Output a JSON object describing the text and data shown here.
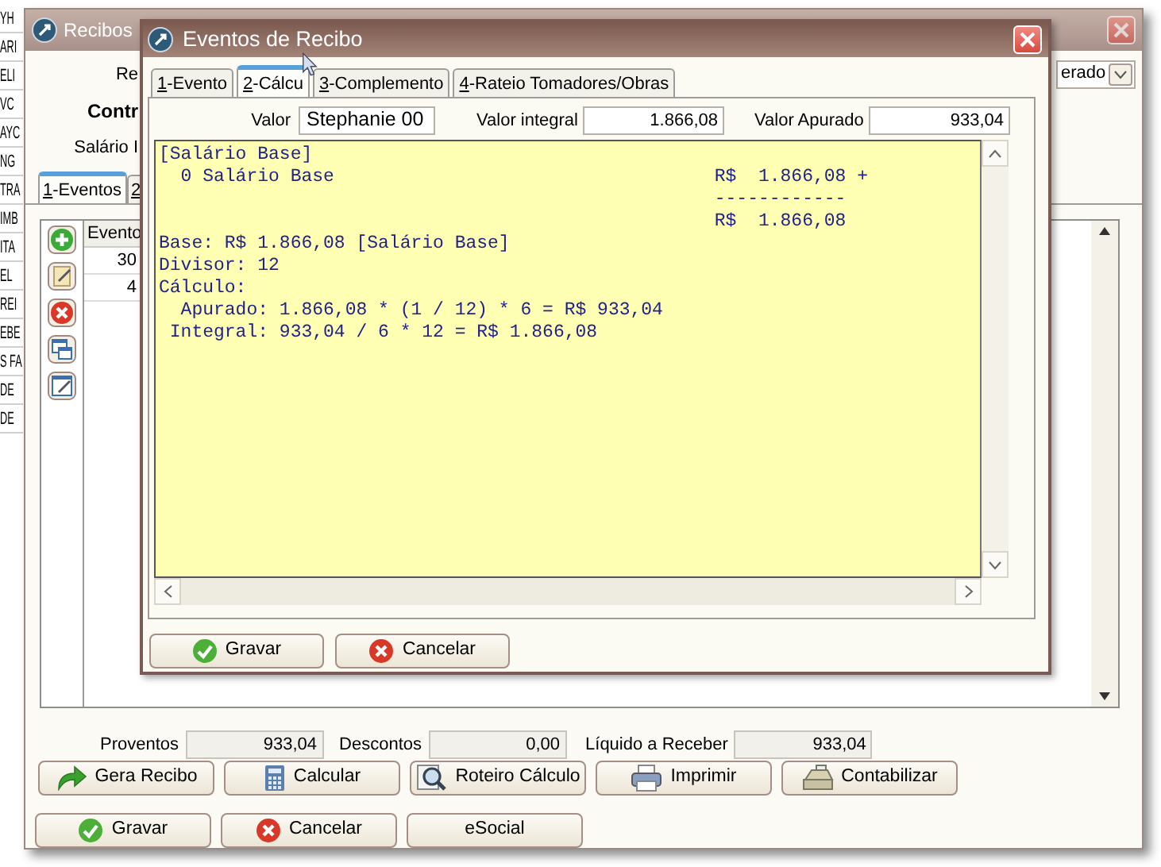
{
  "background_list": {
    "rows": [
      "YH",
      "ARI",
      "ELI",
      "VC",
      "AYC",
      "NG",
      "TRA",
      "IMB",
      "ITA",
      "EL",
      "REI",
      "EBE",
      "S FA",
      "DE",
      "DE"
    ]
  },
  "main_window": {
    "title": "Recibos",
    "labels": [
      {
        "text": "Re",
        "kind": "plain"
      },
      {
        "text": "Contr",
        "kind": "strong"
      },
      {
        "text": "Salário I",
        "kind": "plain"
      }
    ],
    "combo": {
      "value": "erado"
    },
    "tabs": [
      {
        "label": "1-Eventos",
        "selected": true
      },
      {
        "label": "2",
        "selected": false
      }
    ],
    "grid": {
      "columns": [
        "Evento"
      ],
      "rows": [
        "30",
        "4"
      ]
    },
    "totals": [
      {
        "label": "Proventos",
        "value": "933,04"
      },
      {
        "label": "Descontos",
        "value": "0,00"
      },
      {
        "label": "Líquido a Receber",
        "value": "933,04"
      }
    ],
    "actions": [
      "Gera Recibo",
      "Calcular",
      "Roteiro Cálculo",
      "Imprimir",
      "Contabilizar"
    ],
    "buttons": [
      "Gravar",
      "Cancelar",
      "eSocial"
    ]
  },
  "dialog": {
    "title": "Eventos de Recibo",
    "tabs": [
      {
        "label": "1-Evento",
        "selected": false
      },
      {
        "label": "2-Cálcu",
        "selected": true
      },
      {
        "label": "3-Complemento",
        "selected": false
      },
      {
        "label": "4-Rateio Tomadores/Obras",
        "selected": false
      }
    ],
    "fields": [
      {
        "label": "Valor",
        "value": "Stephanie 00"
      },
      {
        "label": "Valor integral",
        "value": "1.866,08"
      },
      {
        "label": "Valor Apurado",
        "value": "933,04"
      }
    ],
    "calc_lines": [
      {
        "text": "[Salário Base]"
      },
      {
        "text": "  0 Salário Base",
        "amount": "R$  1.866,08 +"
      },
      {
        "amount": "------------"
      },
      {
        "amount": "R$  1.866,08"
      },
      {
        "text": "Base: R$ 1.866,08 [Salário Base]"
      },
      {
        "text": "Divisor: 12"
      },
      {
        "text": "Cálculo:"
      },
      {
        "text": "  Apurado: 1.866,08 * (1 / 12) * 6 = R$ 933,04"
      },
      {
        "text": " Integral: 933,04 / 6 * 12 = R$ 1.866,08"
      }
    ],
    "buttons": [
      "Gravar",
      "Cancelar"
    ]
  }
}
